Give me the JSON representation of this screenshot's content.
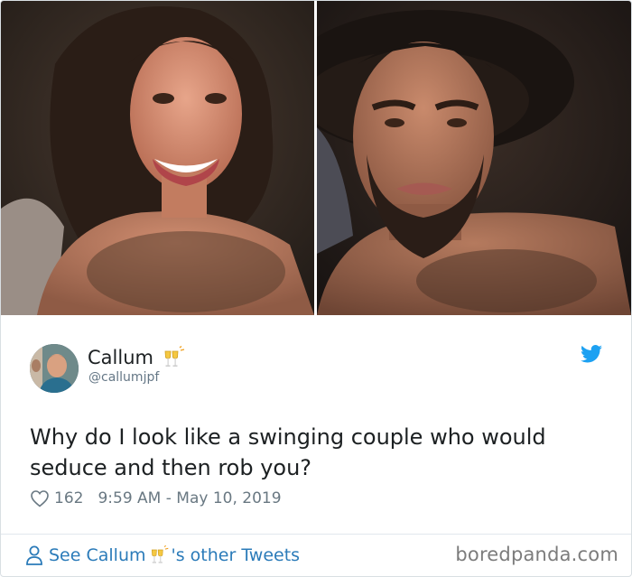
{
  "tweet": {
    "author_name": "Callum",
    "author_handle": "@callumjpf",
    "text": "Why do I look like a swinging couple who would seduce and then rob you?",
    "likes": "162",
    "timestamp": "9:59 AM - May 10, 2019",
    "see_more_prefix": "See Callum",
    "see_more_suffix": "'s other Tweets",
    "name_emoji": "clinking-glasses-emoji"
  },
  "watermark": "boredpanda.com",
  "colors": {
    "text": "#1c2022",
    "secondary": "#697882",
    "link": "#2b7bb9",
    "twitter_blue": "#1da1f2",
    "border": "#d9dfe3"
  },
  "icons": [
    "twitter-bird-icon",
    "heart-icon",
    "person-icon",
    "clinking-glasses-emoji"
  ]
}
